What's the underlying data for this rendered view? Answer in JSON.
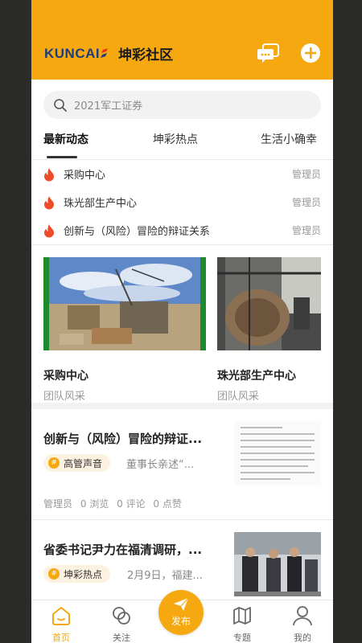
{
  "colors": {
    "accent": "#f5a810",
    "brand_blue": "#1f3d78",
    "bezel": "#2b2b29"
  },
  "header": {
    "logo_text": "KUNCAI",
    "app_name": "坤彩社区",
    "icons": [
      "chat-bubble-icon",
      "plus-circle-icon"
    ]
  },
  "search": {
    "placeholder": "2021军工证券",
    "icon": "search-icon"
  },
  "tabs": [
    {
      "label": "最新动态",
      "active": true
    },
    {
      "label": "坤彩热点",
      "active": false
    },
    {
      "label": "生活小确幸",
      "active": false
    }
  ],
  "notices": [
    {
      "title": "采购中心",
      "author": "管理员",
      "icon": "flame-icon"
    },
    {
      "title": "珠光部生产中心",
      "author": "管理员",
      "icon": "flame-icon"
    },
    {
      "title": "创新与（风险）冒险的辩证关系",
      "author": "管理员",
      "icon": "flame-icon"
    }
  ],
  "cards": [
    {
      "title": "采购中心",
      "subtitle": "团队风采"
    },
    {
      "title": "珠光部生产中心",
      "subtitle": "团队风采"
    }
  ],
  "articles": [
    {
      "title": "创新与（风险）冒险的辩证...",
      "tag": "高管声音",
      "desc": "董事长亲述“...",
      "author": "管理员",
      "views": "0 浏览",
      "comments": "0 评论",
      "likes": "0 点赞"
    },
    {
      "title": "省委书记尹力在福清调研，...",
      "tag": "坤彩热点",
      "desc": "2月9日，福建..."
    }
  ],
  "tabbar": [
    {
      "label": "首页",
      "icon": "home-icon",
      "active": true
    },
    {
      "label": "关注",
      "icon": "follow-circles-icon",
      "active": false
    },
    {
      "label": "专题",
      "icon": "map-book-icon",
      "active": false
    },
    {
      "label": "我的",
      "icon": "person-icon",
      "active": false
    }
  ],
  "publish": {
    "label": "发布",
    "icon": "paper-plane-icon"
  }
}
